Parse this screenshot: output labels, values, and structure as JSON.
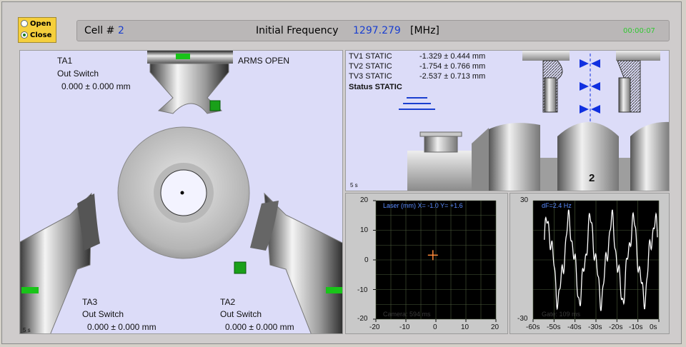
{
  "radio": {
    "options": [
      {
        "label": "Open",
        "selected": false
      },
      {
        "label": "Close",
        "selected": true
      }
    ]
  },
  "header": {
    "cell_label": "Cell #",
    "cell_value": "2",
    "freq_label": "Initial Frequency",
    "freq_value": "1297.279",
    "freq_unit": "[MHz]",
    "timer": "00:00:07"
  },
  "arms": {
    "status": "ARMS OPEN",
    "ta1": {
      "name": "TA1",
      "switch": "Out Switch",
      "value": "0.000 ± 0.000 mm"
    },
    "ta2": {
      "name": "TA2",
      "switch": "Out Switch",
      "value": "0.000 ± 0.000 mm"
    },
    "ta3": {
      "name": "TA3",
      "switch": "Out Switch",
      "value": "0.000 ± 0.000 mm"
    },
    "time_label": "5 s"
  },
  "tv": {
    "rows": [
      {
        "name": "TV1 STATIC",
        "value": "-1.329 ± 0.444 mm"
      },
      {
        "name": "TV2 STATIC",
        "value": "-1.754 ± 0.766 mm"
      },
      {
        "name": "TV3 STATIC",
        "value": "-2.537 ± 0.713 mm"
      }
    ],
    "status": "Status STATIC",
    "cell_number": "2",
    "time_label": "5 s"
  },
  "laser": {
    "title": "Laser (mm) X= -1.0 Y= +1.6",
    "footer": "Camera: 594 ms",
    "yticks": [
      "20",
      "10",
      "0",
      "-10",
      "-20"
    ],
    "xticks": [
      "-20",
      "-10",
      "0",
      "10",
      "20"
    ],
    "point": {
      "x": -1.0,
      "y": 1.6
    }
  },
  "freqplot": {
    "title": "dF=2.4 Hz",
    "footer": "Gate: 109 ms",
    "yticks": [
      "30",
      "-30"
    ],
    "xticks": [
      "-60s",
      "-50s",
      "-40s",
      "-30s",
      "-20s",
      "-10s",
      "0s"
    ]
  },
  "colors": {
    "accent_blue": "#1a3fd0",
    "timer_green": "#31c831",
    "panel_bg": "#dcdcf8",
    "plot_bg": "#000000",
    "indicator_green": "#19c419"
  }
}
